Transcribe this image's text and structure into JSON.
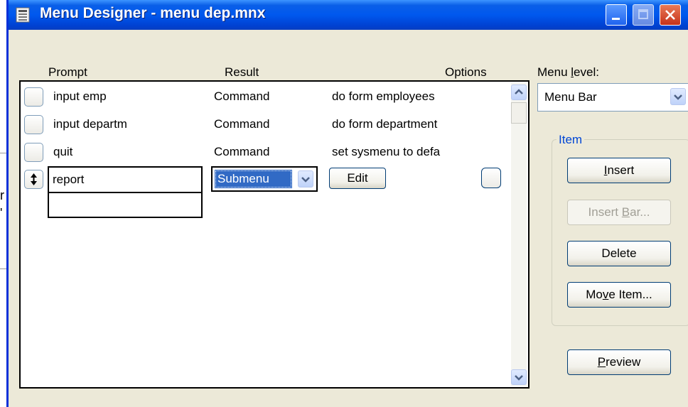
{
  "window": {
    "title": "Menu Designer - menu dep.mnx"
  },
  "background": {
    "fragment_1": "r",
    "fragment_2": "'"
  },
  "columns": {
    "prompt": "Prompt",
    "result": "Result",
    "options": "Options"
  },
  "rows": [
    {
      "prompt": "input emp",
      "result": "Command",
      "option": "do form employees"
    },
    {
      "prompt": "input departm",
      "result": "Command",
      "option": "do form department"
    },
    {
      "prompt": "quit",
      "result": "Command",
      "option": "set sysmenu to defa"
    }
  ],
  "active_row": {
    "prompt": "report",
    "result": "Submenu",
    "edit_label": "Edit"
  },
  "menu_level": {
    "label_pre": "Menu ",
    "label_key": "l",
    "label_post": "evel:",
    "value": "Menu Bar"
  },
  "item_group": {
    "title": "Item",
    "insert": {
      "pre": "",
      "key": "I",
      "post": "nsert"
    },
    "insert_bar": {
      "pre": "Insert ",
      "key": "B",
      "post": "ar..."
    },
    "delete": {
      "pre": "",
      "key": "",
      "post": "Delete"
    },
    "move_item": {
      "pre": "Mo",
      "key": "v",
      "post": "e Item..."
    }
  },
  "preview": {
    "pre": "",
    "key": "P",
    "post": "review"
  },
  "icons": [
    "menu-designer-icon",
    "minimize-icon",
    "maximize-icon",
    "close-icon",
    "move-row-icon",
    "scroll-up-icon",
    "scroll-down-icon",
    "chevron-down-icon"
  ],
  "colors": {
    "titlebar": "#0058ee",
    "selection": "#316ac5",
    "group_title": "#0046d5",
    "dialog_bg": "#ece9d8"
  }
}
